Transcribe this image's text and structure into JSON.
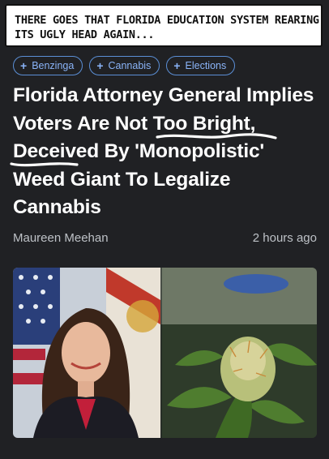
{
  "meme_caption": "There goes that Florida education system rearing its ugly head again...",
  "tags": [
    {
      "label": "Benzinga"
    },
    {
      "label": "Cannabis"
    },
    {
      "label": "Elections"
    }
  ],
  "article": {
    "headline": {
      "part1": "Florida Attorney General Implies Voters ",
      "underlined1": "Are Not Too",
      "space": " ",
      "underlined2": "Bright",
      "part2": ", Deceived By 'Monopolistic' Weed Giant To Legalize Cannabis"
    },
    "author": "Maureen Meehan",
    "timestamp": "2 hours ago"
  },
  "colors": {
    "background": "#202124",
    "chip_border": "#5b8fd6",
    "chip_text": "#8ab4f8",
    "headline": "#ffffff",
    "meta_text": "#bdc1c6"
  }
}
